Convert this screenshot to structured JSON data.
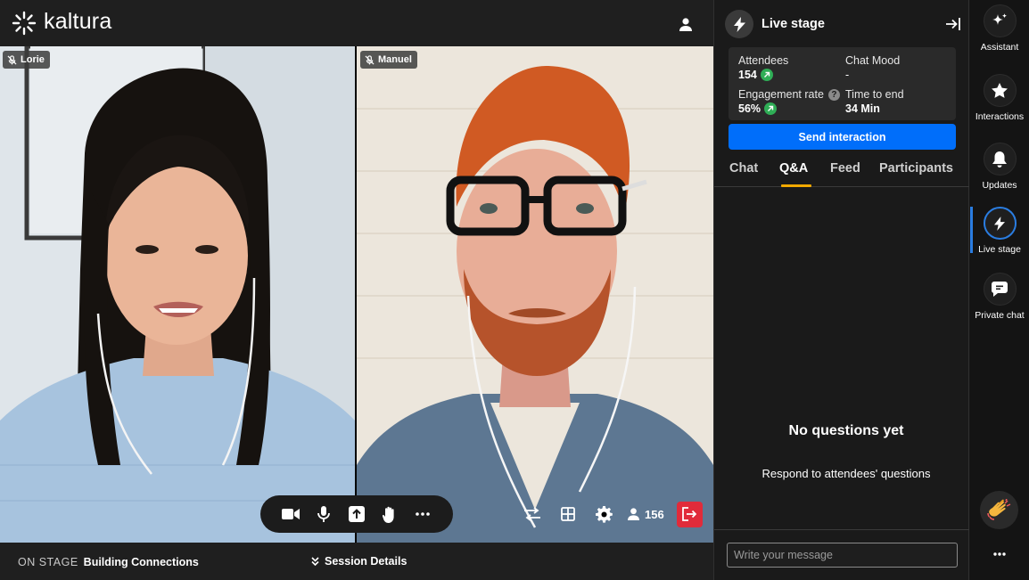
{
  "app": {
    "brand": "kaltura"
  },
  "video": {
    "tiles": [
      {
        "name": "Lorie",
        "muted": true
      },
      {
        "name": "Manuel",
        "muted": true
      }
    ]
  },
  "controls": {
    "participant_count": "156",
    "left_icons": [
      "camera-icon",
      "microphone-icon",
      "share-screen-icon",
      "raise-hand-icon",
      "more-icon"
    ],
    "right_icons": [
      "layout-switch-icon",
      "grid-icon",
      "gear-icon",
      "person-icon",
      "leave-icon"
    ]
  },
  "bottom_bar": {
    "on_stage_label": "ON STAGE",
    "session_title": "Building Connections",
    "session_details": "Session Details"
  },
  "panel": {
    "title": "Live stage",
    "stats": {
      "attendees_label": "Attendees",
      "attendees_value": "154",
      "chat_mood_label": "Chat Mood",
      "chat_mood_value": "-",
      "engagement_label": "Engagement rate",
      "engagement_value": "56%",
      "time_label": "Time to end",
      "time_value": "34 Min"
    },
    "send_button": "Send interaction",
    "tabs": [
      "Chat",
      "Q&A",
      "Feed",
      "Participants"
    ],
    "active_tab": "Q&A",
    "empty_title": "No questions yet",
    "empty_subtitle": "Respond to attendees' questions",
    "message_placeholder": "Write your message"
  },
  "rail": {
    "items": [
      {
        "label": "Assistant",
        "icon": "sparkle-icon"
      },
      {
        "label": "Interactions",
        "icon": "star-icon"
      },
      {
        "label": "Updates",
        "icon": "bell-icon"
      },
      {
        "label": "Live stage",
        "icon": "lightning-icon",
        "active": true
      },
      {
        "label": "Private chat",
        "icon": "chat-bubble-icon"
      }
    ]
  },
  "colors": {
    "accent_blue": "#006efa",
    "tab_underline": "#f2a900",
    "leave_red": "#e12b3a",
    "trend_green": "#2fae56"
  }
}
